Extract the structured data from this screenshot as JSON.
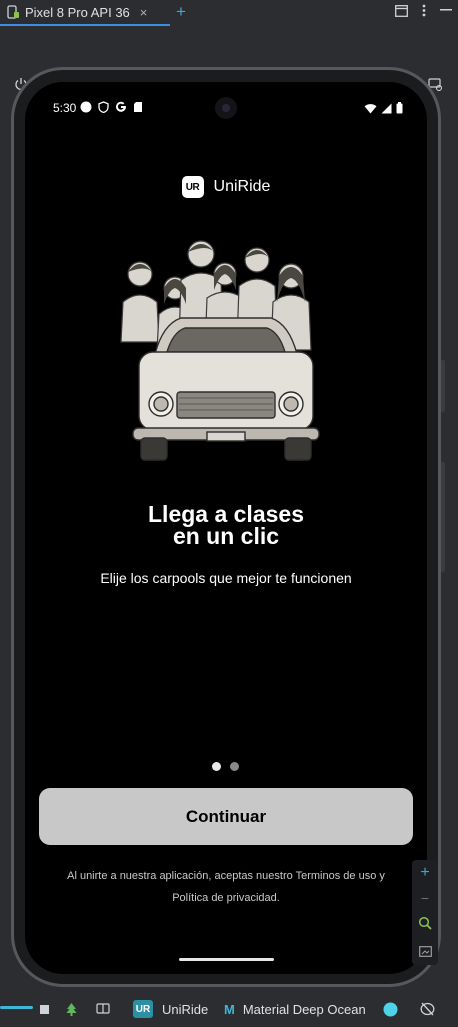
{
  "window": {
    "tab_title": "Pixel 8 Pro API 36",
    "tab_close": "×",
    "new_tab": "+"
  },
  "status_bar": {
    "time": "5:30"
  },
  "app": {
    "brand_logo_text": "UR",
    "brand_name": "UniRide",
    "headline_line1": "Llega a clases",
    "headline_line2": "en un clic",
    "subtitle": "Elije los carpools que mejor te funcionen",
    "continue_label": "Continuar",
    "terms_line1": "Al unirte a nuestra aplicación, aceptas nuestro Terminos de uso y",
    "terms_line2": "Política de privacidad.",
    "page_indicator": {
      "total": 2,
      "current": 1
    }
  },
  "zoom_panel": {
    "plus": "+",
    "minus": "−"
  },
  "bottom_bar": {
    "project_badge": "UR",
    "project_name": "UniRide",
    "theme_icon": "M",
    "theme_name": "Material Deep Ocean"
  },
  "colors": {
    "accent": "#3d8ee0",
    "screen_bg": "#000000",
    "button_bg": "#c8c8c8",
    "badge": "#2c8fa3"
  }
}
